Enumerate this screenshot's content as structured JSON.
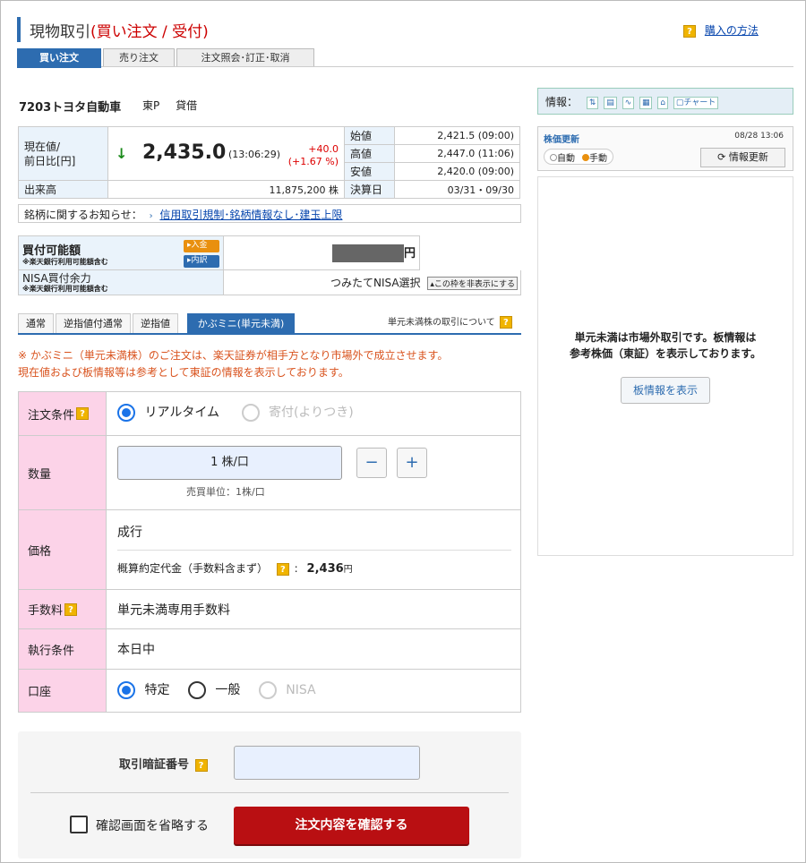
{
  "header": {
    "title_main": "現物取引",
    "title_sub": "(買い注文 / 受付)",
    "howto_label": "購入の方法"
  },
  "tabs": [
    {
      "label": "買い注文"
    },
    {
      "label": "売り注文"
    },
    {
      "label": "注文照会･訂正･取消"
    }
  ],
  "stock": {
    "code_name": "7203トヨタ自動車",
    "market": "東P",
    "margin": "貸借"
  },
  "quote": {
    "price_label": "現在値/\n前日比[円]",
    "arrow": "↓",
    "price": "2,435.0",
    "time": "(13:06:29)",
    "change": "+40.0",
    "change_pct": "(+1.67 %)",
    "open_label": "始値",
    "open": "2,421.5 (09:00)",
    "high_label": "高値",
    "high": "2,447.0 (11:06)",
    "low_label": "安値",
    "low": "2,420.0 (09:00)",
    "volume_label": "出来高",
    "volume": "11,875,200 株",
    "settle_label": "決算日",
    "settle": "03/31・09/30"
  },
  "notice": {
    "label": "銘柄に関するお知らせ：",
    "link": "信用取引規制･銘柄情報なし･建玉上限"
  },
  "buying": {
    "power_label": "買付可能額",
    "power_note": "※楽天銀行利用可能額含む",
    "deposit_btn": "入金",
    "detail_btn": "内訳",
    "yen": "円",
    "nisa_label": "NISA買付余力",
    "nisa_note": "※楽天銀行利用可能額含む",
    "nisa_value": "つみたてNISA選択",
    "nisa_hide_btn": "この枠を非表示にする"
  },
  "subtabs": [
    {
      "label": "通常"
    },
    {
      "label": "逆指値付通常"
    },
    {
      "label": "逆指値"
    },
    {
      "label": "かぶミニ(単元未満)"
    }
  ],
  "subtab_help": "単元未満株の取引について",
  "warning": {
    "line1": "※ かぶミニ（単元未満株）のご注文は、楽天証券が相手方となり市場外で成立させます。",
    "line2": "現在値および板情報等は参考として東証の情報を表示しております。"
  },
  "form": {
    "condition_label": "注文条件",
    "realtime": "リアルタイム",
    "yoritsuki": "寄付(よりつき)",
    "qty_label": "数量",
    "qty_value": "1 株/口",
    "minus": "−",
    "plus": "+",
    "unit_note": "売買単位：1株/口",
    "price_label": "価格",
    "price_value": "成行",
    "estimate_label": "概算約定代金（手数料含まず）",
    "estimate_value": "2,436",
    "estimate_unit": "円",
    "fee_label": "手数料",
    "fee_value": "単元未満専用手数料",
    "exec_label": "執行条件",
    "exec_value": "本日中",
    "account_label": "口座",
    "acct_tokutei": "特定",
    "acct_ippan": "一般",
    "acct_nisa": "NISA"
  },
  "confirm": {
    "pw_label": "取引暗証番号",
    "skip_label": "確認画面を省略する",
    "submit": "注文内容を確認する"
  },
  "right": {
    "info_label": "情報：",
    "chart_btn": "チャート",
    "update_title": "株価更新",
    "update_time": "08/28 13:06",
    "auto": "自動",
    "manual": "手動",
    "refresh_btn": "情報更新",
    "msg_line1": "単元未満は市場外取引です。板情報は",
    "msg_line2": "参考株価（東証）を表示しております。",
    "board_btn": "板情報を表示"
  },
  "colors": {
    "accent": "#2d6cb0",
    "submit": "#b90f12",
    "label_pink": "#fcd3e8",
    "warn": "#d9531e"
  }
}
